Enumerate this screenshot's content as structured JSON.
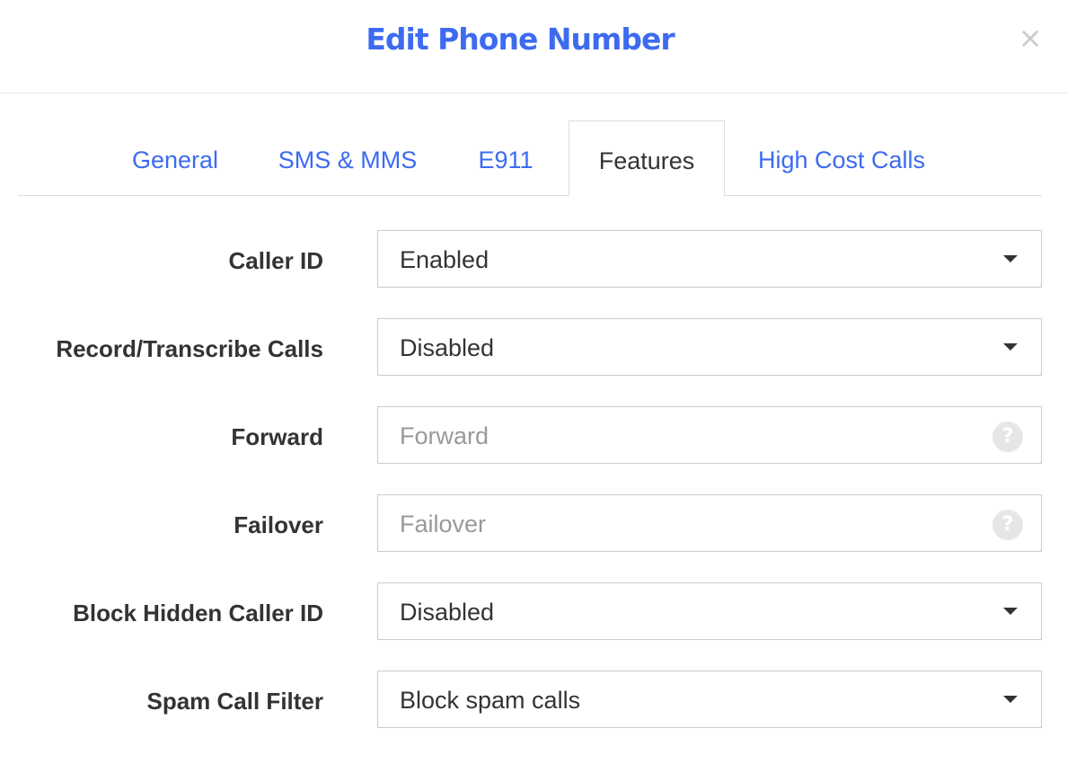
{
  "modal": {
    "title": "Edit Phone Number",
    "close_label": "×"
  },
  "tabs": [
    {
      "label": "General",
      "active": false
    },
    {
      "label": "SMS & MMS",
      "active": false
    },
    {
      "label": "E911",
      "active": false
    },
    {
      "label": "Features",
      "active": true
    },
    {
      "label": "High Cost Calls",
      "active": false
    }
  ],
  "fields": {
    "caller_id": {
      "label": "Caller ID",
      "value": "Enabled",
      "type": "select"
    },
    "record_transcribe": {
      "label": "Record/Transcribe Calls",
      "value": "Disabled",
      "type": "select"
    },
    "forward": {
      "label": "Forward",
      "placeholder": "Forward",
      "type": "text",
      "help_icon": "help-icon"
    },
    "failover": {
      "label": "Failover",
      "placeholder": "Failover",
      "type": "text",
      "help_icon": "help-icon"
    },
    "block_hidden": {
      "label": "Block Hidden Caller ID",
      "value": "Disabled",
      "type": "select"
    },
    "spam_filter": {
      "label": "Spam Call Filter",
      "value": "Block spam calls",
      "type": "select"
    }
  },
  "help_glyph": "?",
  "colors": {
    "accent": "#3d6bf0",
    "text": "#333333",
    "placeholder": "#999999",
    "border": "#cccccc"
  }
}
